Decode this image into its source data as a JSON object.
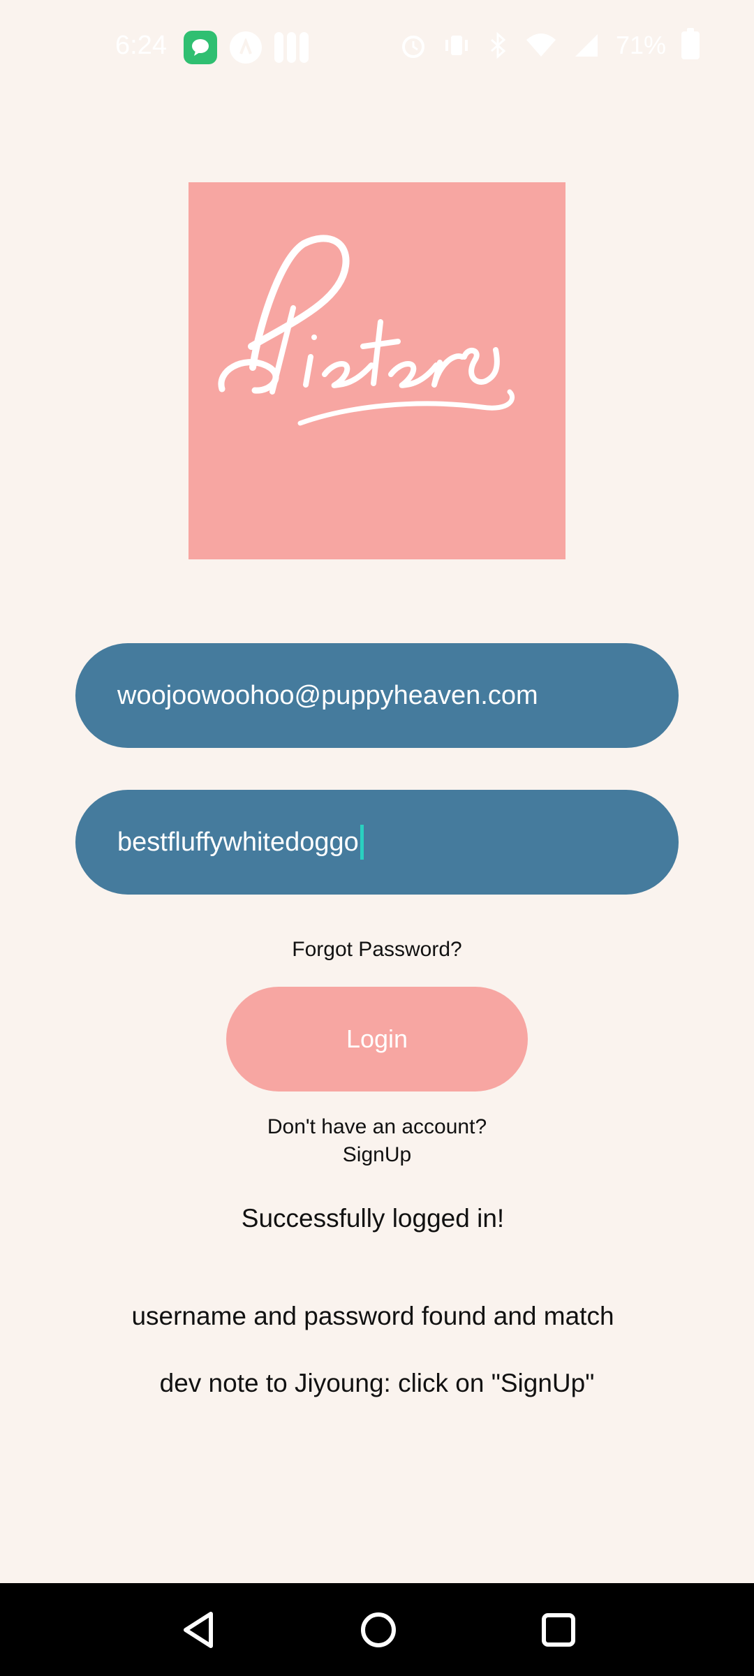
{
  "status_bar": {
    "time": "6:24",
    "battery": "71%",
    "icons": [
      "messages-app-icon",
      "app-circle-icon",
      "app-pill-icon",
      "alarm-icon",
      "vibrate-icon",
      "bluetooth-icon",
      "wifi-icon",
      "signal-icon",
      "battery-icon"
    ]
  },
  "logo": {
    "text": "Pieters",
    "background": "#f7a6a2"
  },
  "login_form": {
    "email_value": "woojoowoohoo@puppyheaven.com",
    "password_value": "bestfluffywhitedoggo",
    "forgot_password": "Forgot Password?",
    "login_label": "Login",
    "no_account": "Don't have an account?",
    "signup_label": "SignUp"
  },
  "messages": {
    "success": "Successfully logged in!",
    "match": "username and password found and match",
    "dev_note": "dev note to Jiyoung: click on \"SignUp\""
  },
  "colors": {
    "background": "#faf3ee",
    "field": "#457b9d",
    "accent_pink": "#f7a6a2",
    "cursor": "#2ad0c0"
  },
  "nav_bar": {
    "buttons": [
      "back-icon",
      "home-icon",
      "recents-icon"
    ]
  }
}
